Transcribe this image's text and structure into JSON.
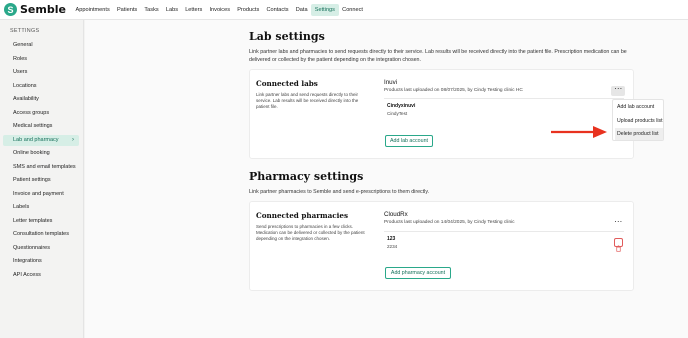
{
  "app": {
    "logo_mark": "S",
    "name": "Semble"
  },
  "topnav": {
    "items": [
      {
        "label": "Appointments",
        "active": false
      },
      {
        "label": "Patients",
        "active": false
      },
      {
        "label": "Tasks",
        "active": false
      },
      {
        "label": "Labs",
        "active": false
      },
      {
        "label": "Letters",
        "active": false
      },
      {
        "label": "Invoices",
        "active": false
      },
      {
        "label": "Products",
        "active": false
      },
      {
        "label": "Contacts",
        "active": false
      },
      {
        "label": "Data",
        "active": false
      },
      {
        "label": "Settings",
        "active": true
      },
      {
        "label": "Connect",
        "active": false
      }
    ]
  },
  "sidebar": {
    "heading": "SETTINGS",
    "items": [
      {
        "label": "General"
      },
      {
        "label": "Roles"
      },
      {
        "label": "Users"
      },
      {
        "label": "Locations"
      },
      {
        "label": "Availability"
      },
      {
        "label": "Access groups"
      },
      {
        "label": "Medical settings"
      },
      {
        "label": "Lab and pharmacy",
        "active": true,
        "chevron": "›"
      },
      {
        "label": "Online booking"
      },
      {
        "label": "SMS and email templates"
      },
      {
        "label": "Patient settings"
      },
      {
        "label": "Invoice and payment"
      },
      {
        "label": "Labels"
      },
      {
        "label": "Letter templates"
      },
      {
        "label": "Consultation templates"
      },
      {
        "label": "Questionnaires"
      },
      {
        "label": "Integrations"
      },
      {
        "label": "API Access"
      }
    ]
  },
  "lab_settings": {
    "title": "Lab settings",
    "description_1": "Link partner labs and pharmacies to send requests directly to their service. Lab results will be received directly into the patient file. Prescription medication can be",
    "description_2": "delivered or collected by the patient depending on the integration chosen.",
    "card": {
      "title": "Connected labs",
      "desc_1": "Link partner labs and send requests directly to their",
      "desc_2": "service. Lab results will be received directly into the",
      "desc_3": "patient file.",
      "provider_name": "Inuvi",
      "provider_sub": "Products last uploaded on 08/07/2025, by Cindy Testing clinic HC",
      "account_name": "Cindyxinuvi",
      "account_sub": "CindyTest",
      "add_button": "Add lab account",
      "more_icon": "⋯"
    },
    "menu": {
      "items": [
        "Add lab account",
        "Upload products list",
        "Delete product list"
      ]
    }
  },
  "pharmacy_settings": {
    "title": "Pharmacy settings",
    "description": "Link partner pharmacies to Semble and send e-prescriptions to them directly.",
    "card": {
      "title": "Connected pharmacies",
      "desc_1": "Send prescriptions to pharmacies in a few clicks.",
      "desc_2": "Medication can be delivered or collected by the patient",
      "desc_3": "depending on the integration chosen.",
      "provider_name": "CloudRx",
      "provider_sub": "Products last uploaded on 14/04/2025, by Cindy Testing clinic",
      "account_name": "123",
      "account_sub": "2234",
      "add_button": "Add pharmacy account",
      "more_icon": "⋯"
    }
  },
  "colors": {
    "accent": "#2aa88a",
    "accent_bg": "#d6eee6",
    "danger": "#e15b5b",
    "annotation_arrow": "#e8321f"
  }
}
